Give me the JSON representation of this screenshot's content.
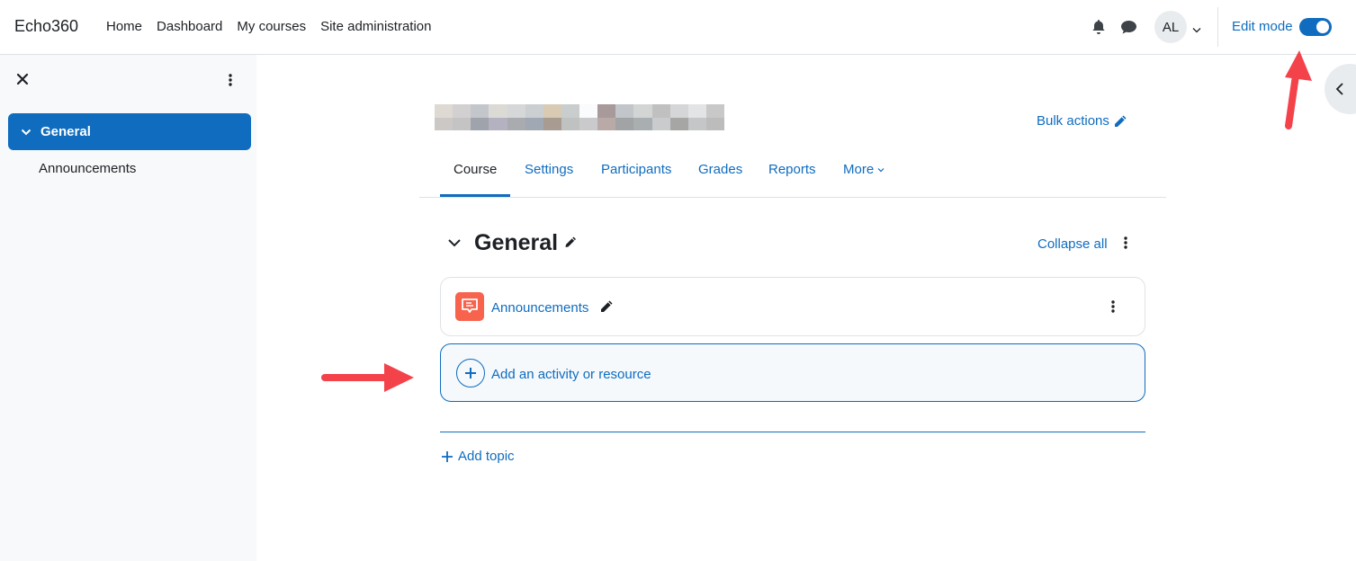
{
  "navbar": {
    "brand": "Echo360",
    "links": [
      "Home",
      "Dashboard",
      "My courses",
      "Site administration"
    ],
    "user_initials": "AL",
    "edit_mode_label": "Edit mode",
    "edit_mode_on": true
  },
  "drawer": {
    "section_label": "General",
    "items": [
      "Announcements"
    ]
  },
  "course": {
    "title_redacted": true,
    "bulk_actions_label": "Bulk actions",
    "tabs": [
      {
        "label": "Course",
        "active": true
      },
      {
        "label": "Settings",
        "active": false
      },
      {
        "label": "Participants",
        "active": false
      },
      {
        "label": "Grades",
        "active": false
      },
      {
        "label": "Reports",
        "active": false
      },
      {
        "label": "More",
        "active": false
      }
    ]
  },
  "section": {
    "title": "General",
    "collapse_all_label": "Collapse all",
    "activities": [
      {
        "name": "Announcements",
        "type": "forum",
        "icon_color": "#f7634d"
      }
    ],
    "add_activity_label": "Add an activity or resource",
    "add_topic_label": "Add topic"
  },
  "colors": {
    "primary": "#0f6cbf",
    "annotation_arrow": "#f4424b"
  }
}
